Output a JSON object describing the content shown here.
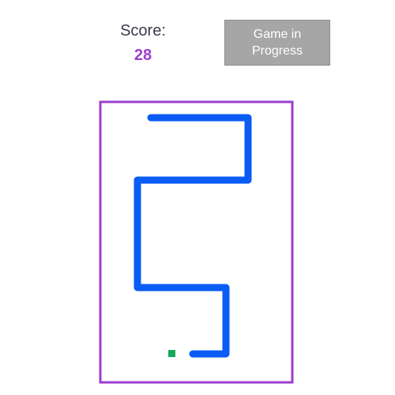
{
  "header": {
    "score_label": "Score:",
    "score_value": "28",
    "status_button_label": "Game in Progress"
  },
  "board": {
    "border_color": "#9b3fcf",
    "snake_color": "#0a5cf5",
    "food_color": "#1aa85a",
    "score_color": "#9b3fcf"
  },
  "snake": {
    "length_cells": 28
  },
  "icons": {
    "food": "food-pellet-icon"
  }
}
